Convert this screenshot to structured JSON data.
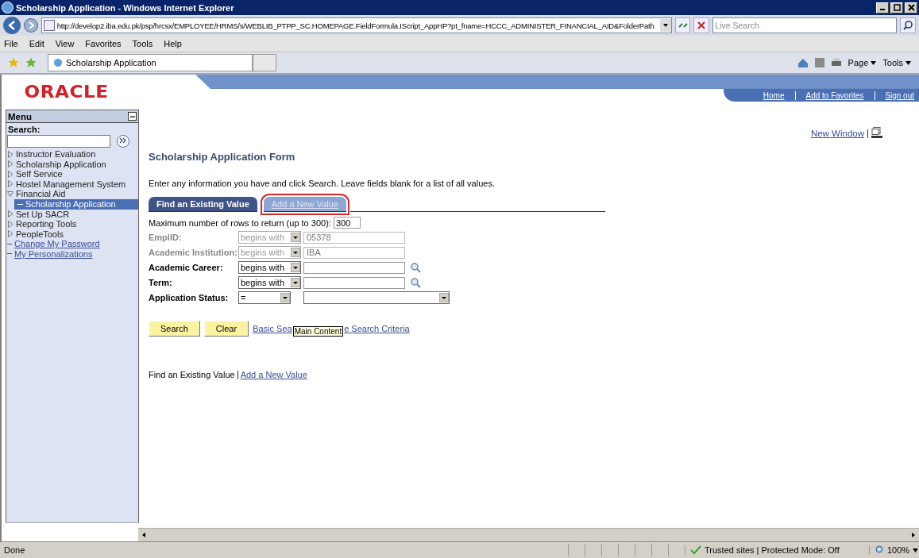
{
  "window": {
    "title": "Scholarship Application - Windows Internet Explorer"
  },
  "address_bar": {
    "url": "http://develop2.iba.edu.pk/psp/hrcsx/EMPLOYEE/HRMS/s/WEBLIB_PTPP_SC.HOMEPAGE.FieldFormula.IScript_AppHP?pt_fname=HCCC_ADMINISTER_FINANCIAL_AID&FolderPath",
    "search_placeholder": "Live Search"
  },
  "menu_bar": [
    "File",
    "Edit",
    "View",
    "Favorites",
    "Tools",
    "Help"
  ],
  "browser_tab": {
    "title": "Scholarship Application"
  },
  "command_bar": [
    "Page",
    "Tools"
  ],
  "header": {
    "logo": "ORACLE",
    "links": [
      "Home",
      "Add to Favorites",
      "Sign out"
    ]
  },
  "sidebar": {
    "title": "Menu",
    "search_label": "Search:",
    "items": [
      {
        "kind": "folder",
        "label": "Instructor Evaluation",
        "expanded": false
      },
      {
        "kind": "folder",
        "label": "Scholarship Application",
        "expanded": false
      },
      {
        "kind": "folder",
        "label": "Self Service",
        "expanded": false
      },
      {
        "kind": "folder",
        "label": "Hostel Management System",
        "expanded": false
      },
      {
        "kind": "folder",
        "label": "Financial Aid",
        "expanded": true,
        "children": [
          {
            "label": "Scholarship Application",
            "selected": true
          }
        ]
      },
      {
        "kind": "folder",
        "label": "Set Up SACR",
        "expanded": false
      },
      {
        "kind": "folder",
        "label": "Reporting Tools",
        "expanded": false
      },
      {
        "kind": "folder",
        "label": "PeopleTools",
        "expanded": false
      },
      {
        "kind": "link",
        "label": "Change My Password"
      },
      {
        "kind": "link",
        "label": "My Personalizations"
      }
    ]
  },
  "main": {
    "new_window": "New Window",
    "title": "Scholarship Application Form",
    "instructions": "Enter any information you have and click Search. Leave fields blank for a list of all values.",
    "tabs": [
      {
        "label": "Find an Existing Value",
        "selected": true
      },
      {
        "label": "Add a New Value",
        "selected": false,
        "highlighted": true
      }
    ],
    "max_rows": {
      "label": "Maximum number of rows to return (up to 300):",
      "value": "300"
    },
    "fields": [
      {
        "label": "EmplID:",
        "operator": "begins with",
        "value": "05378",
        "disabled": true,
        "kind": "lookup"
      },
      {
        "label": "Academic Institution:",
        "operator": "begins with",
        "value": "IBA",
        "disabled": true,
        "kind": "lookup"
      },
      {
        "label": "Academic Career:",
        "operator": "begins with",
        "disabled": false,
        "kind": "lookup"
      },
      {
        "label": "Term:",
        "operator": "begins with",
        "disabled": false,
        "kind": "lookup"
      },
      {
        "label": "Application Status:",
        "operator": "=",
        "disabled": false,
        "kind": "select"
      }
    ],
    "buttons": [
      "Search",
      "Clear"
    ],
    "links": [
      "Basic Sea",
      "e Search Criteria"
    ],
    "tooltip": "Main Content",
    "footer_links": [
      "Find an Existing Value",
      "Add a New Value"
    ]
  },
  "status_bar": {
    "text": "Done",
    "zone": "Trusted sites | Protected Mode: Off",
    "zoom": "100%"
  }
}
